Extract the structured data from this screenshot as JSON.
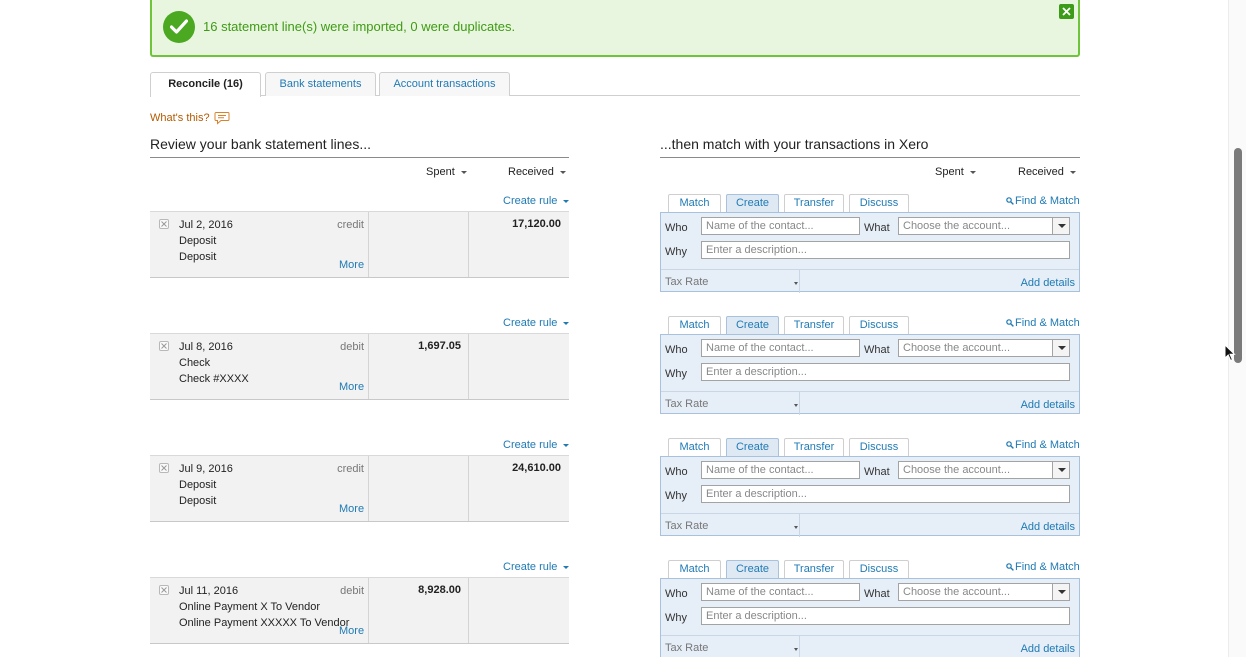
{
  "banner": {
    "message": "16 statement line(s) were imported, 0 were duplicates.",
    "colors": {
      "background": "#e9f6df",
      "border": "#6ec53a",
      "accent": "#4aa821"
    }
  },
  "tabs": [
    {
      "label": "Reconcile (16)",
      "active": true
    },
    {
      "label": "Bank statements",
      "active": false
    },
    {
      "label": "Account transactions",
      "active": false
    }
  ],
  "help": {
    "label": "What's this?"
  },
  "left": {
    "heading": "Review your bank statement lines...",
    "spent_header": "Spent",
    "received_header": "Received",
    "create_rule_label": "Create rule",
    "more_label": "More"
  },
  "right": {
    "heading": "...then match with your transactions in Xero",
    "spent_header": "Spent",
    "received_header": "Received"
  },
  "statements": [
    {
      "date": "Jul 2, 2016",
      "type": "credit",
      "line1": "Deposit",
      "line2": "Deposit",
      "spent": "",
      "received": "17,120.00"
    },
    {
      "date": "Jul 8, 2016",
      "type": "debit",
      "line1": "Check",
      "line2": "Check #XXXX",
      "spent": "1,697.05",
      "received": ""
    },
    {
      "date": "Jul 9, 2016",
      "type": "credit",
      "line1": "Deposit",
      "line2": "Deposit",
      "spent": "",
      "received": "24,610.00"
    },
    {
      "date": "Jul 11, 2016",
      "type": "debit",
      "line1": "Online Payment X To Vendor",
      "line2": "Online Payment XXXXX To Vendor",
      "spent": "8,928.00",
      "received": ""
    }
  ],
  "match_panel": {
    "tabs": [
      "Match",
      "Create",
      "Transfer",
      "Discuss"
    ],
    "active_tab": "Create",
    "find_match": "Find & Match",
    "who_label": "Who",
    "who_placeholder": "Name of the contact...",
    "what_label": "What",
    "what_placeholder": "Choose the account...",
    "why_label": "Why",
    "why_placeholder": "Enter a description...",
    "tax_rate_label": "Tax Rate",
    "add_details": "Add details"
  }
}
